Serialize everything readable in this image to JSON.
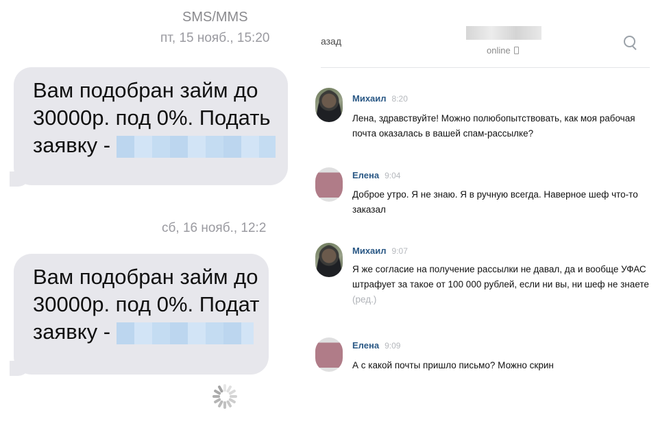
{
  "sms": {
    "header_title": "SMS/MMS",
    "messages": [
      {
        "date": "пт, 15 нояб., 15:20",
        "lines": [
          "Вам подобран займ до",
          "30000р. под 0%. Подать",
          "заявку - "
        ]
      },
      {
        "date": "сб, 16 нояб., 12:2",
        "lines": [
          "Вам подобран займ до",
          "30000р. под 0%. Подат",
          "заявку - "
        ]
      }
    ]
  },
  "chat": {
    "back_label": "азад",
    "status": "online",
    "messages": [
      {
        "author": "Михаил",
        "time": "8:20",
        "text": "Лена, здравствуйте! Можно полюбопытствовать, как моя рабочая почта оказалась в вашей спам-рассылке?",
        "edited": ""
      },
      {
        "author": "Елена",
        "time": "9:04",
        "text": "Доброе утро. Я не знаю. Я в ручную всегда. Наверное шеф что-то заказал",
        "edited": ""
      },
      {
        "author": "Михаил",
        "time": "9:07",
        "text": "Я же согласие на получение рассылки не давал, да и вообще УФАС штрафует за такое от 100 000 рублей, если ни вы, ни шеф не знаете",
        "edited": "(ред.)"
      },
      {
        "author": "Елена",
        "time": "9:09",
        "text": "А с какой почты пришло письмо? Можно скрин",
        "edited": ""
      }
    ]
  }
}
